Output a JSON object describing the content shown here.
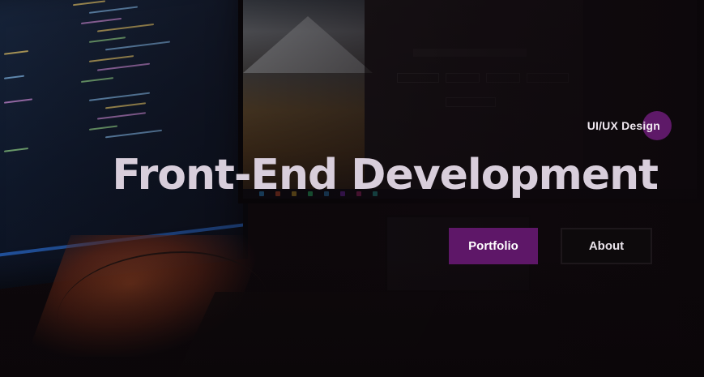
{
  "hero": {
    "tagline": "UI/UX Design",
    "headline": "Front-End Development",
    "buttons": {
      "portfolio_label": "Portfolio",
      "about_label": "About"
    }
  },
  "colors": {
    "accent": "#5e1768",
    "headline_text": "#d8cedb",
    "background": "#0e080c"
  },
  "background_image": "dim photo of a desk with monitors showing code and an app, laptop and keyboard"
}
